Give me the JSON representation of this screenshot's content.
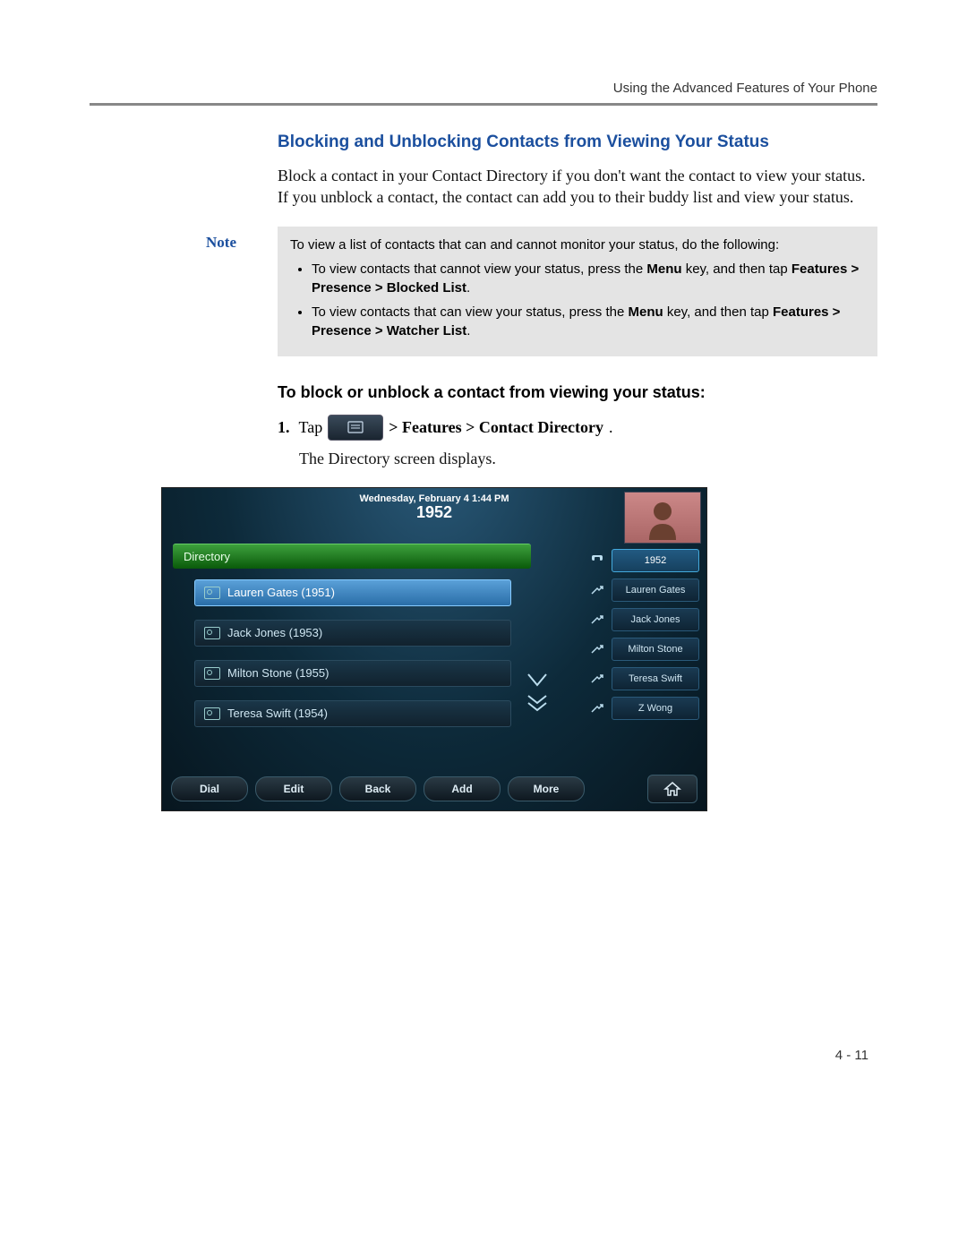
{
  "header": {
    "running": "Using the Advanced Features of Your Phone"
  },
  "section": {
    "title": "Blocking and Unblocking Contacts from Viewing Your Status",
    "intro": "Block a contact in your Contact Directory if you don't want the contact to view your status. If you unblock a contact, the contact can add you to their buddy list and view your status."
  },
  "note": {
    "label": "Note",
    "lead": "To view a list of contacts that can and cannot monitor your status, do the following:",
    "b1_a": "To view contacts that cannot view your status, press the ",
    "b1_key": "Menu",
    "b1_b": " key, and then tap ",
    "b1_path": "Features > Presence > Blocked List",
    "b2_a": "To view contacts that can view your status, press the ",
    "b2_key": "Menu",
    "b2_b": " key, and then tap ",
    "b2_path": "Features > Presence > Watcher List"
  },
  "procedure": {
    "heading": "To block or unblock a contact from viewing your status:",
    "step_num": "1.",
    "step_tap": "Tap",
    "step_path": " > Features > Contact Directory",
    "step_result": "The Directory screen displays."
  },
  "phone": {
    "date": "Wednesday, February 4  1:44 PM",
    "ext": "1952",
    "directory_label": "Directory",
    "contacts": [
      {
        "label": "Lauren Gates (1951)",
        "selected": true
      },
      {
        "label": "Jack Jones (1953)",
        "selected": false
      },
      {
        "label": "Milton Stone (1955)",
        "selected": false
      },
      {
        "label": "Teresa Swift (1954)",
        "selected": false
      }
    ],
    "side": [
      {
        "label": "1952",
        "highlight": true,
        "icon": "handset"
      },
      {
        "label": "Lauren Gates",
        "highlight": false,
        "icon": "speed"
      },
      {
        "label": "Jack Jones",
        "highlight": false,
        "icon": "speed"
      },
      {
        "label": "Milton Stone",
        "highlight": false,
        "icon": "speed"
      },
      {
        "label": "Teresa Swift",
        "highlight": false,
        "icon": "speed"
      },
      {
        "label": "Z Wong",
        "highlight": false,
        "icon": "speed"
      }
    ],
    "softkeys": [
      "Dial",
      "Edit",
      "Back",
      "Add",
      "More"
    ]
  },
  "footer": {
    "page": "4 - 11"
  }
}
